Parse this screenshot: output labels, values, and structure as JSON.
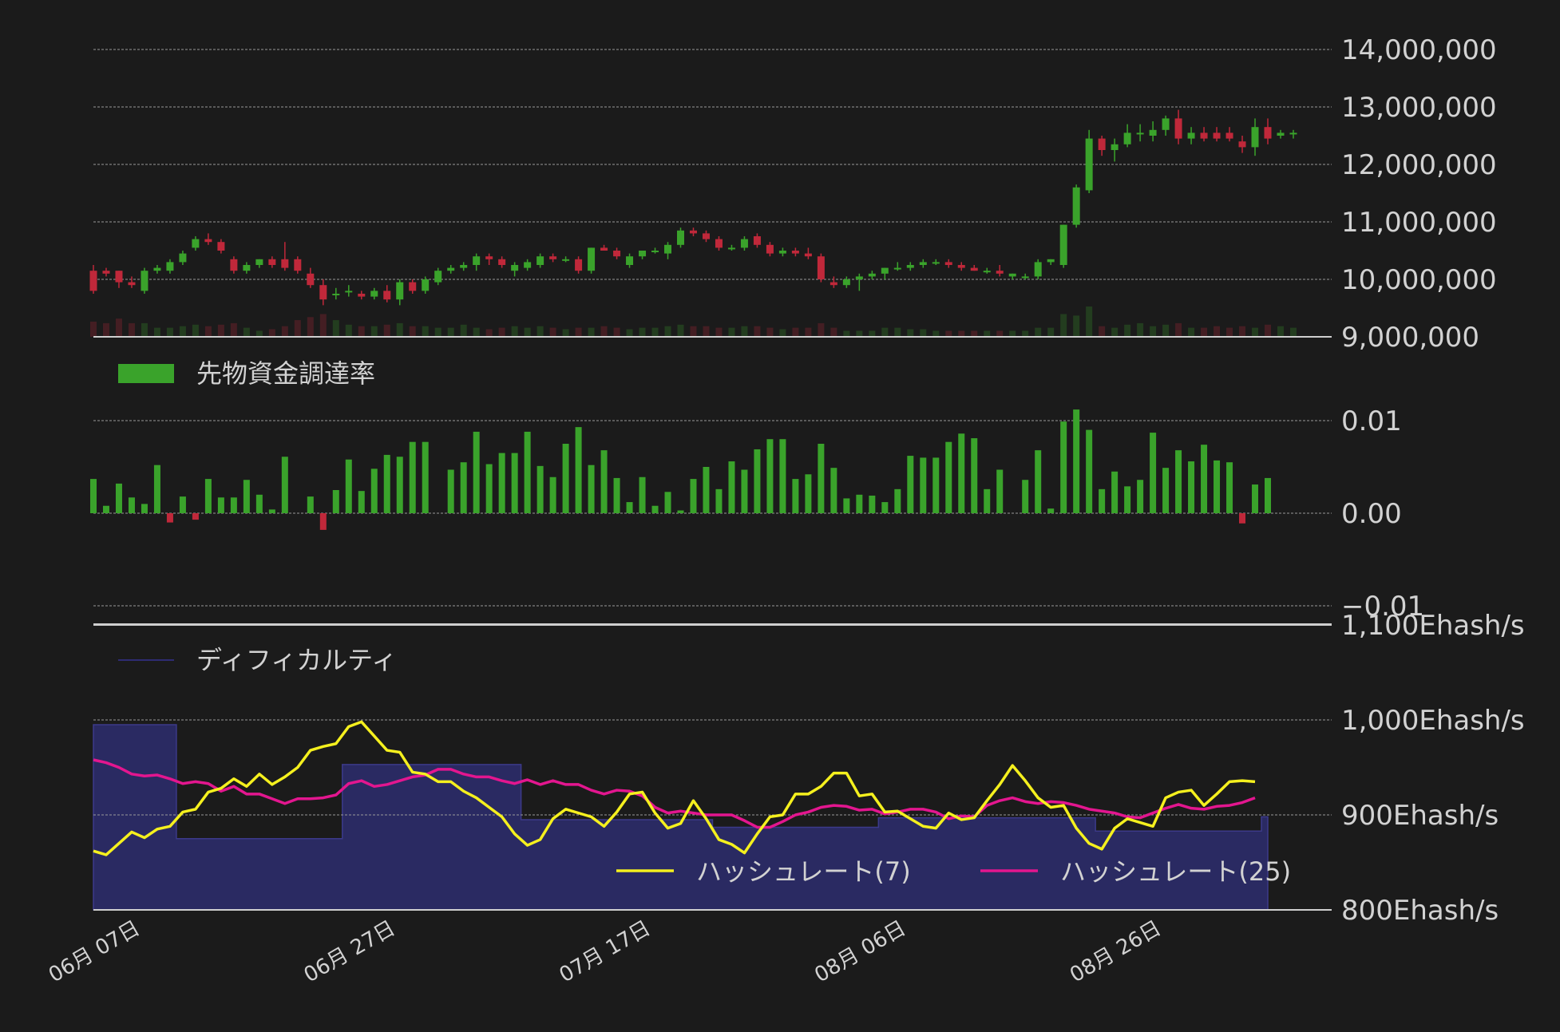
{
  "chart_data": [
    {
      "type": "candlestick",
      "panel": "price",
      "ylim": [
        9000000,
        14000000
      ],
      "yticks": [
        9000000,
        10000000,
        11000000,
        12000000,
        13000000,
        14000000
      ],
      "ytick_labels": [
        "9,000,000",
        "10,000,000",
        "11,000,000",
        "12,000,000",
        "13,000,000",
        "14,000,000"
      ],
      "colors": {
        "up": "#3aa32b",
        "down": "#c0283a"
      },
      "ohlc": [
        [
          10150000,
          10250000,
          9750000,
          9800000
        ],
        [
          10150000,
          10200000,
          10050000,
          10100000
        ],
        [
          10150000,
          10150000,
          9850000,
          9950000
        ],
        [
          9950000,
          10050000,
          9850000,
          9900000
        ],
        [
          9800000,
          10200000,
          9750000,
          10150000
        ],
        [
          10150000,
          10250000,
          10100000,
          10200000
        ],
        [
          10150000,
          10350000,
          10100000,
          10300000
        ],
        [
          10300000,
          10500000,
          10250000,
          10450000
        ],
        [
          10550000,
          10750000,
          10500000,
          10700000
        ],
        [
          10700000,
          10800000,
          10600000,
          10650000
        ],
        [
          10650000,
          10700000,
          10450000,
          10500000
        ],
        [
          10350000,
          10400000,
          10100000,
          10150000
        ],
        [
          10150000,
          10300000,
          10100000,
          10250000
        ],
        [
          10250000,
          10350000,
          10200000,
          10350000
        ],
        [
          10350000,
          10400000,
          10200000,
          10250000
        ],
        [
          10350000,
          10650000,
          10150000,
          10200000
        ],
        [
          10350000,
          10400000,
          10100000,
          10150000
        ],
        [
          10100000,
          10200000,
          9850000,
          9900000
        ],
        [
          9900000,
          10000000,
          9550000,
          9650000
        ],
        [
          9750000,
          9850000,
          9650000,
          9750000
        ],
        [
          9800000,
          9900000,
          9700000,
          9800000
        ],
        [
          9750000,
          9800000,
          9650000,
          9700000
        ],
        [
          9700000,
          9850000,
          9650000,
          9800000
        ],
        [
          9800000,
          9900000,
          9600000,
          9650000
        ],
        [
          9650000,
          10000000,
          9550000,
          9950000
        ],
        [
          9950000,
          10000000,
          9750000,
          9800000
        ],
        [
          9800000,
          10050000,
          9750000,
          10000000
        ],
        [
          9950000,
          10200000,
          9900000,
          10150000
        ],
        [
          10150000,
          10250000,
          10100000,
          10200000
        ],
        [
          10200000,
          10300000,
          10150000,
          10250000
        ],
        [
          10250000,
          10450000,
          10150000,
          10400000
        ],
        [
          10400000,
          10450000,
          10250000,
          10350000
        ],
        [
          10350000,
          10400000,
          10200000,
          10250000
        ],
        [
          10150000,
          10300000,
          10050000,
          10250000
        ],
        [
          10200000,
          10350000,
          10150000,
          10300000
        ],
        [
          10250000,
          10450000,
          10200000,
          10400000
        ],
        [
          10400000,
          10450000,
          10300000,
          10350000
        ],
        [
          10350000,
          10400000,
          10300000,
          10350000
        ],
        [
          10350000,
          10400000,
          10100000,
          10150000
        ],
        [
          10150000,
          10550000,
          10100000,
          10550000
        ],
        [
          10550000,
          10600000,
          10500000,
          10500000
        ],
        [
          10500000,
          10550000,
          10350000,
          10400000
        ],
        [
          10250000,
          10450000,
          10200000,
          10400000
        ],
        [
          10400000,
          10500000,
          10350000,
          10500000
        ],
        [
          10500000,
          10550000,
          10450000,
          10500000
        ],
        [
          10450000,
          10650000,
          10350000,
          10600000
        ],
        [
          10600000,
          10900000,
          10550000,
          10850000
        ],
        [
          10850000,
          10900000,
          10750000,
          10800000
        ],
        [
          10800000,
          10850000,
          10650000,
          10700000
        ],
        [
          10700000,
          10750000,
          10500000,
          10550000
        ],
        [
          10550000,
          10600000,
          10500000,
          10550000
        ],
        [
          10550000,
          10750000,
          10500000,
          10700000
        ],
        [
          10750000,
          10800000,
          10550000,
          10600000
        ],
        [
          10600000,
          10650000,
          10400000,
          10450000
        ],
        [
          10450000,
          10550000,
          10400000,
          10500000
        ],
        [
          10500000,
          10550000,
          10400000,
          10450000
        ],
        [
          10450000,
          10550000,
          10350000,
          10400000
        ],
        [
          10400000,
          10450000,
          9950000,
          10000000
        ],
        [
          9950000,
          10050000,
          9850000,
          9900000
        ],
        [
          9900000,
          10050000,
          9850000,
          10000000
        ],
        [
          10000000,
          10100000,
          9800000,
          10050000
        ],
        [
          10050000,
          10150000,
          10000000,
          10100000
        ],
        [
          10100000,
          10200000,
          10000000,
          10200000
        ],
        [
          10200000,
          10300000,
          10150000,
          10200000
        ],
        [
          10200000,
          10300000,
          10150000,
          10250000
        ],
        [
          10250000,
          10350000,
          10200000,
          10300000
        ],
        [
          10300000,
          10350000,
          10250000,
          10300000
        ],
        [
          10300000,
          10350000,
          10200000,
          10250000
        ],
        [
          10250000,
          10300000,
          10150000,
          10200000
        ],
        [
          10200000,
          10250000,
          10150000,
          10150000
        ],
        [
          10150000,
          10200000,
          10100000,
          10150000
        ],
        [
          10150000,
          10250000,
          10050000,
          10100000
        ],
        [
          10050000,
          10100000,
          10000000,
          10100000
        ],
        [
          10050000,
          10100000,
          10000000,
          10050000
        ],
        [
          10050000,
          10350000,
          10000000,
          10300000
        ],
        [
          10300000,
          10350000,
          10250000,
          10350000
        ],
        [
          10250000,
          10950000,
          10200000,
          10950000
        ],
        [
          10950000,
          11650000,
          10900000,
          11600000
        ],
        [
          11550000,
          12600000,
          11500000,
          12450000
        ],
        [
          12450000,
          12500000,
          12150000,
          12250000
        ],
        [
          12250000,
          12450000,
          12050000,
          12350000
        ],
        [
          12350000,
          12700000,
          12300000,
          12550000
        ],
        [
          12550000,
          12700000,
          12400000,
          12550000
        ],
        [
          12500000,
          12750000,
          12400000,
          12600000
        ],
        [
          12600000,
          12850000,
          12500000,
          12800000
        ],
        [
          12800000,
          12950000,
          12350000,
          12450000
        ],
        [
          12450000,
          12650000,
          12350000,
          12550000
        ],
        [
          12550000,
          12650000,
          12400000,
          12450000
        ],
        [
          12550000,
          12650000,
          12400000,
          12450000
        ],
        [
          12550000,
          12650000,
          12400000,
          12450000
        ],
        [
          12400000,
          12500000,
          12200000,
          12300000
        ],
        [
          12300000,
          12800000,
          12150000,
          12650000
        ],
        [
          12650000,
          12800000,
          12350000,
          12450000
        ],
        [
          12500000,
          12600000,
          12450000,
          12550000
        ],
        [
          12550000,
          12600000,
          12450000,
          12550000
        ]
      ],
      "volume": [
        0.5,
        0.45,
        0.6,
        0.45,
        0.45,
        0.3,
        0.3,
        0.35,
        0.4,
        0.35,
        0.4,
        0.45,
        0.3,
        0.2,
        0.25,
        0.35,
        0.55,
        0.65,
        0.75,
        0.55,
        0.4,
        0.35,
        0.35,
        0.4,
        0.45,
        0.35,
        0.35,
        0.3,
        0.3,
        0.4,
        0.3,
        0.25,
        0.3,
        0.35,
        0.3,
        0.35,
        0.3,
        0.25,
        0.3,
        0.3,
        0.35,
        0.3,
        0.25,
        0.3,
        0.3,
        0.35,
        0.4,
        0.35,
        0.35,
        0.3,
        0.3,
        0.35,
        0.35,
        0.3,
        0.25,
        0.3,
        0.3,
        0.45,
        0.3,
        0.2,
        0.2,
        0.2,
        0.3,
        0.3,
        0.25,
        0.25,
        0.2,
        0.2,
        0.2,
        0.2,
        0.2,
        0.2,
        0.2,
        0.2,
        0.3,
        0.3,
        0.75,
        0.7,
        1.0,
        0.35,
        0.3,
        0.4,
        0.45,
        0.35,
        0.4,
        0.45,
        0.3,
        0.3,
        0.35,
        0.3,
        0.35,
        0.3,
        0.4,
        0.35,
        0.3
      ]
    },
    {
      "type": "bar",
      "panel": "funding",
      "legend": [
        "先物資金調達率"
      ],
      "series": [
        {
          "name": "先物資金調達率",
          "color": "#3aa32b",
          "negative_color": "#c0283a",
          "values": [
            0.0037,
            0.0008,
            0.0032,
            0.0017,
            0.001,
            0.0052,
            -0.001,
            0.0018,
            -0.0007,
            0.0037,
            0.0017,
            0.0017,
            0.0036,
            0.002,
            0.0004,
            0.0061,
            0,
            0.0018,
            -0.0018,
            0.0025,
            0.0058,
            0.0024,
            0.0048,
            0.0063,
            0.0061,
            0.0077,
            0.0077,
            0,
            0.0047,
            0.0055,
            0.0088,
            0.0053,
            0.0065,
            0.0065,
            0.0088,
            0.0051,
            0.0039,
            0.0075,
            0.0093,
            0.0052,
            0.0068,
            0.0038,
            0.0012,
            0.0039,
            0.0008,
            0.0023,
            0.0003,
            0.0037,
            0.005,
            0.0026,
            0.0056,
            0.0047,
            0.0069,
            0.008,
            0.008,
            0.0037,
            0.0042,
            0.0075,
            0.0049,
            0.0016,
            0.002,
            0.0019,
            0.0012,
            0.0026,
            0.0062,
            0.006,
            0.006,
            0.0077,
            0.0086,
            0.0081,
            0.0026,
            0.0047,
            0,
            0.0036,
            0.0068,
            0.0005,
            0.0099,
            0.0112,
            0.009,
            0.0026,
            0.0045,
            0.0029,
            0.0036,
            0.0087,
            0.0049,
            0.0068,
            0.0056,
            0.0074,
            0.0057,
            0.0055,
            -0.0011,
            0.0031,
            0.0038
          ]
        }
      ],
      "ylim": [
        -0.01,
        0.01
      ],
      "yticks": [
        -0.01,
        0.0,
        0.01
      ],
      "ytick_labels": [
        "−0.01",
        "0.00",
        "0.01"
      ]
    },
    {
      "type": "line+area",
      "panel": "hashrate",
      "ylim": [
        800,
        1100
      ],
      "yticks": [
        800,
        900,
        1000,
        1100
      ],
      "ytick_labels": [
        "800Ehash/s",
        "900Ehash/s",
        "1,000Ehash/s",
        "1,100Ehash/s"
      ],
      "legend_area": "ディフィカルティ",
      "series": [
        {
          "name": "ハッシュレート(7)",
          "color": "#f5f01e",
          "values": [
            862,
            858,
            870,
            882,
            876,
            885,
            888,
            903,
            906,
            924,
            928,
            938,
            930,
            943,
            932,
            940,
            950,
            968,
            972,
            975,
            993,
            998,
            983,
            968,
            966,
            945,
            943,
            935,
            935,
            925,
            918,
            908,
            898,
            880,
            868,
            874,
            896,
            906,
            902,
            898,
            888,
            903,
            922,
            924,
            902,
            886,
            891,
            915,
            896,
            874,
            869,
            860,
            880,
            898,
            900,
            922,
            922,
            930,
            944,
            944,
            920,
            922,
            903,
            904,
            896,
            888,
            886,
            902,
            895,
            897,
            915,
            932,
            952,
            936,
            918,
            908,
            910,
            886,
            870,
            864,
            886,
            896,
            892,
            888,
            918,
            924,
            926,
            910,
            922,
            935,
            936,
            935
          ]
        },
        {
          "name": "ハッシュレート(25)",
          "color": "#e3168f",
          "values": [
            958,
            955,
            950,
            943,
            941,
            942,
            938,
            933,
            935,
            933,
            925,
            930,
            922,
            922,
            917,
            912,
            917,
            917,
            918,
            921,
            933,
            936,
            930,
            932,
            936,
            940,
            942,
            948,
            948,
            943,
            940,
            940,
            936,
            933,
            937,
            932,
            936,
            932,
            932,
            926,
            922,
            926,
            925,
            920,
            908,
            902,
            904,
            902,
            900,
            900,
            900,
            894,
            887,
            887,
            893,
            900,
            903,
            908,
            910,
            909,
            905,
            906,
            901,
            903,
            906,
            906,
            903,
            896,
            899,
            898,
            910,
            915,
            918,
            914,
            912,
            914,
            913,
            910,
            906,
            904,
            902,
            898,
            897,
            902,
            907,
            911,
            907,
            906,
            909,
            910,
            913,
            918
          ]
        },
        {
          "name": "ディフィカルティ",
          "color": "#2e2c73",
          "type": "area",
          "values": [
            995,
            995,
            995,
            995,
            995,
            995,
            995,
            875,
            875,
            875,
            875,
            875,
            875,
            875,
            875,
            875,
            875,
            875,
            875,
            875,
            875,
            875,
            875,
            875,
            875,
            875,
            875,
            875,
            875,
            875,
            875,
            875,
            875,
            875,
            875,
            875,
            875,
            875,
            875,
            875,
            875,
            875,
            875,
            875,
            875,
            875,
            875,
            875,
            875,
            875,
            875,
            875,
            875,
            875,
            875,
            875,
            875,
            875,
            875,
            875,
            875,
            875,
            875,
            875,
            875,
            875,
            875,
            875,
            875,
            875,
            875,
            875,
            875,
            875,
            875,
            875,
            875,
            875,
            875,
            875,
            875,
            875,
            875,
            875,
            875,
            875,
            875,
            875,
            875,
            875,
            875,
            875
          ]
        }
      ]
    }
  ],
  "difficulty_steps": [
    {
      "from": 0,
      "to": 6,
      "value": 995
    },
    {
      "from": 7,
      "to": 19,
      "value": 875
    },
    {
      "from": 20,
      "to": 33,
      "value": 953
    },
    {
      "from": 34,
      "to": 48,
      "value": 895
    },
    {
      "from": 49,
      "to": 61,
      "value": 887
    },
    {
      "from": 62,
      "to": 78,
      "value": 897
    },
    {
      "from": 79,
      "to": 91,
      "value": 883
    },
    {
      "from": 92,
      "to": 92,
      "value": 898
    }
  ],
  "x_axis": {
    "ticks": [
      {
        "index": 0,
        "label": "06月 07日"
      },
      {
        "index": 20,
        "label": "06月 27日"
      },
      {
        "index": 40,
        "label": "07月 17日"
      },
      {
        "index": 60,
        "label": "08月 06日"
      },
      {
        "index": 80,
        "label": "08月 26日"
      }
    ]
  }
}
